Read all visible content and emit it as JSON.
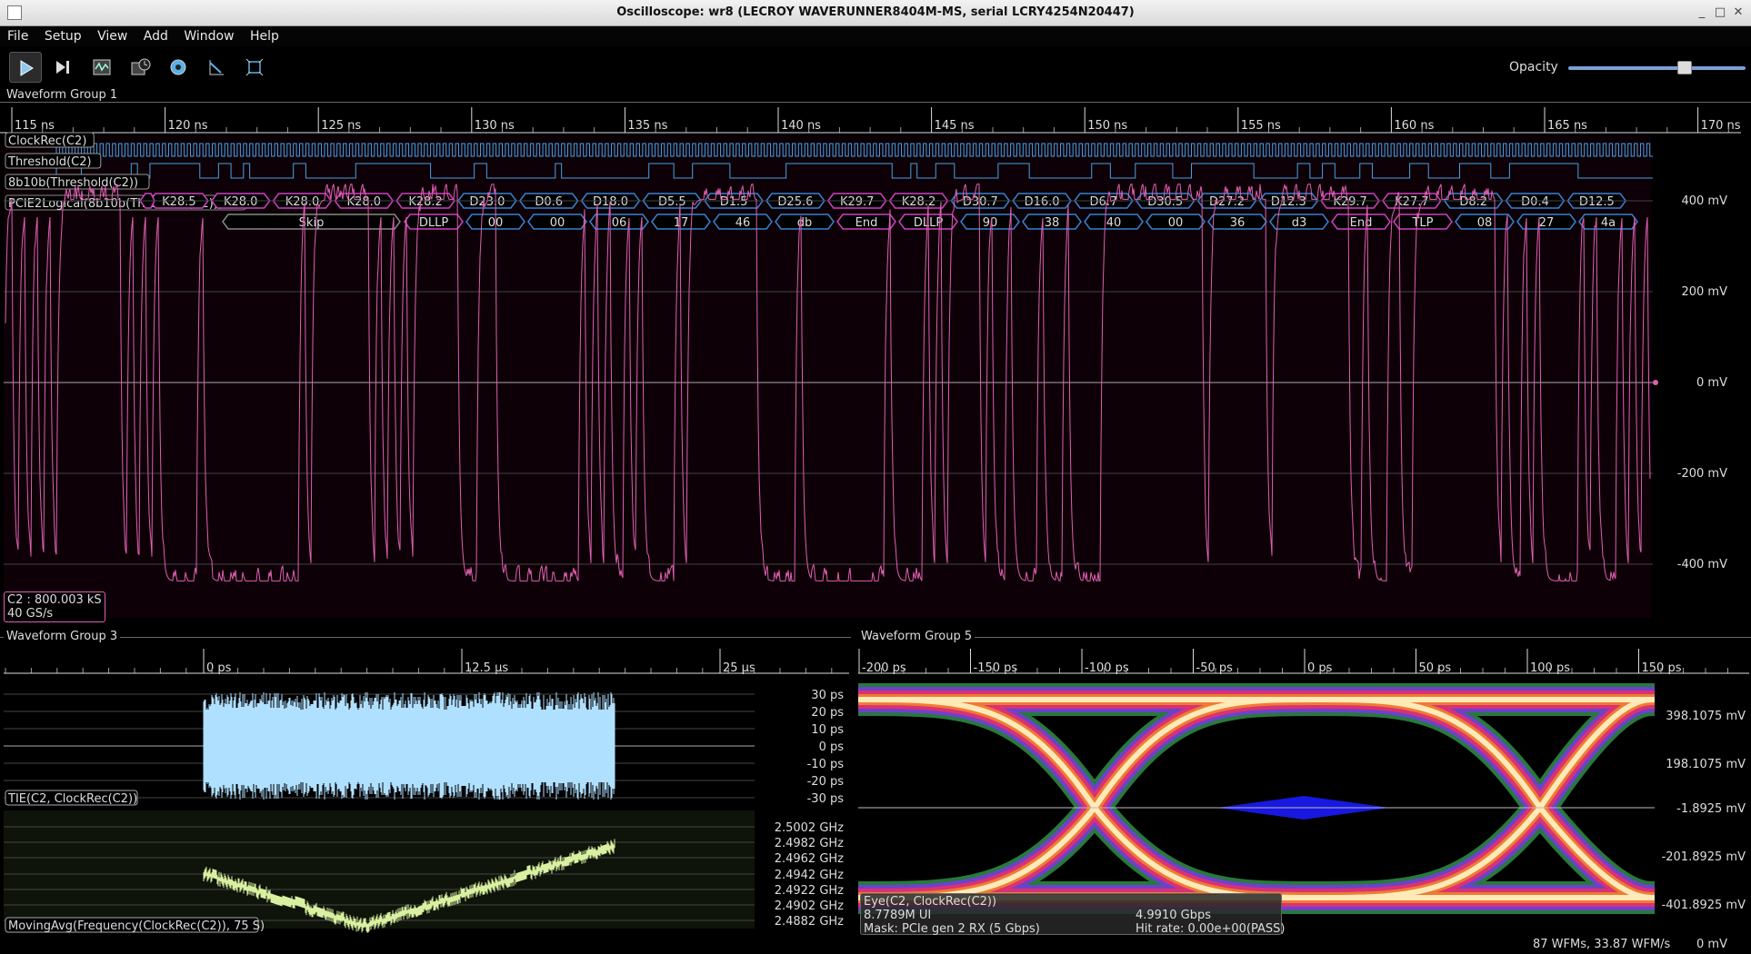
{
  "window": {
    "title": "Oscilloscope: wr8 (LECROY WAVERUNNER8404M-MS, serial LCRY4254N20447)"
  },
  "menu": [
    "File",
    "Setup",
    "View",
    "Add",
    "Window",
    "Help"
  ],
  "toolbar": {
    "buttons": [
      "play-icon",
      "step-icon",
      "waveform-icon",
      "history-icon",
      "settings-icon",
      "cursor-icon",
      "fit-icon"
    ],
    "opacity_label": "Opacity",
    "opacity_value": 0.77
  },
  "group1": {
    "title": "Waveform Group 1",
    "time_ticks": [
      "115 ns",
      "120 ns",
      "125 ns",
      "130 ns",
      "135 ns",
      "140 ns",
      "145 ns",
      "150 ns",
      "155 ns",
      "160 ns",
      "165 ns",
      "170 ns"
    ],
    "y_ticks": [
      "400 mV",
      "200 mV",
      "0 mV",
      "-200 mV",
      "-400 mV"
    ],
    "channel_labels": [
      "ClockRec(C2)",
      "Threshold(C2)",
      "8b10b(Threshold(C2))",
      "PCIE2Logical(8b10b(Threshold(C2)))"
    ],
    "symbols": [
      "K28.5",
      "K28.0",
      "K28.0",
      "K28.0",
      "K28.2",
      "D23.0",
      "D0.6",
      "D18.0",
      "D5.5",
      "D1.5",
      "D25.6",
      "K29.7",
      "K28.2",
      "D30.7",
      "D16.0",
      "D6.7",
      "D30.5",
      "D27.2",
      "D12.3",
      "K29.7",
      "K27.7",
      "D8.2",
      "D0.4",
      "D12.5"
    ],
    "logical": [
      "Skip",
      "DLLP",
      "00",
      "00",
      "06",
      "17",
      "46",
      "db",
      "End",
      "DLLP",
      "90",
      "38",
      "40",
      "00",
      "36",
      "d3",
      "End",
      "TLP",
      "08",
      "27",
      "4a"
    ],
    "channel_info": [
      "C2 : 800.003 kS",
      "40 GS/s"
    ]
  },
  "group3": {
    "title": "Waveform Group 3",
    "time_ticks": [
      "0 ps",
      "12.5 µs",
      "25 µs"
    ],
    "tie_label": "TIE(C2, ClockRec(C2))",
    "tie_y_ticks": [
      "30 ps",
      "20 ps",
      "10 ps",
      "0 ps",
      "-10 ps",
      "-20 ps",
      "-30 ps"
    ],
    "freq_label": "MovingAvg(Frequency(ClockRec(C2)), 75 S)",
    "freq_y_ticks": [
      "2.5002 GHz",
      "2.4982 GHz",
      "2.4962 GHz",
      "2.4942 GHz",
      "2.4922 GHz",
      "2.4902 GHz",
      "2.4882 GHz"
    ]
  },
  "group5": {
    "title": "Waveform Group 5",
    "time_ticks": [
      "-200 ps",
      "-150 ps",
      "-100 ps",
      "-50 ps",
      "0 ps",
      "50 ps",
      "100 ps",
      "150 ps"
    ],
    "y_ticks": [
      "398.1075 mV",
      "198.1075 mV",
      "-1.8925 mV",
      "-201.8925 mV",
      "-401.8925 mV"
    ],
    "eye_info": [
      "Eye(C2, ClockRec(C2))",
      "8.7789M UI",
      "Mask: PCIe gen 2 RX (5 Gbps)"
    ],
    "eye_rate": "4.9910 Gbps",
    "eye_hit": "Hit rate: 0.00e+00(PASS)"
  },
  "status": {
    "text": "87 WFMs, 33.87 WFM/s",
    "mv": "0 mV"
  },
  "colors": {
    "analog": "#e060b0",
    "digital": "#4aa0e0",
    "symbol_k": "#d040c0",
    "symbol_d": "#3a80d0",
    "tie": "#b0e0ff",
    "freq": "#d8f0a0"
  }
}
